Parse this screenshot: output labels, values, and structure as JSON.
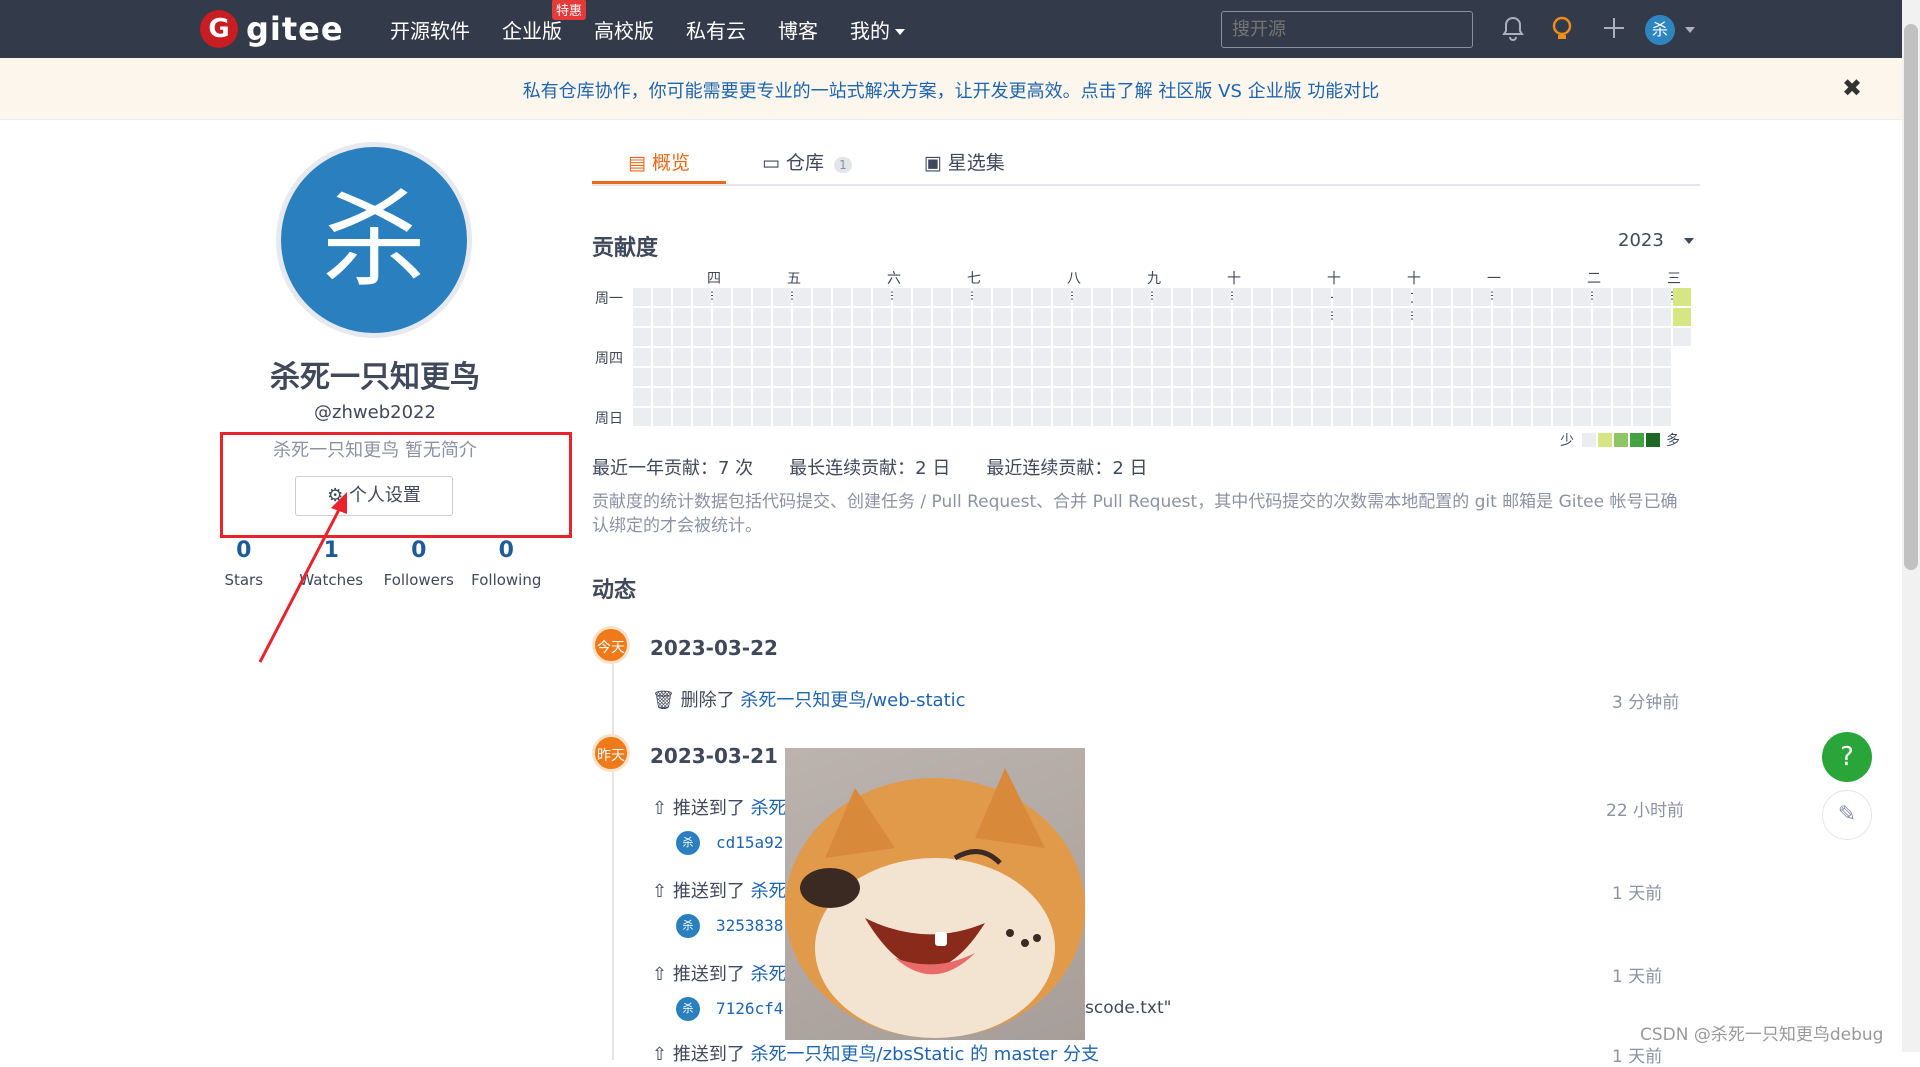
{
  "logo": {
    "mark": "G",
    "text": "gitee"
  },
  "nav": [
    {
      "label": "开源软件"
    },
    {
      "label": "企业版",
      "badge": "特惠"
    },
    {
      "label": "高校版"
    },
    {
      "label": "私有云"
    },
    {
      "label": "博客"
    },
    {
      "label": "我的"
    }
  ],
  "search": {
    "placeholder": "搜开源"
  },
  "user_avatar_initial": "杀",
  "banner": {
    "text": "私有仓库协作，你可能需要更专业的一站式解决方案，让开发更高效。点击了解 社区版 VS 企业版 功能对比",
    "close": "✖"
  },
  "profile": {
    "avatar_initial": "杀",
    "name": "杀死一只知更鸟",
    "username": "@zhweb2022",
    "bio": "杀死一只知更鸟 暂无简介",
    "settings_label": "个人设置",
    "stats": [
      {
        "num": "0",
        "label": "Stars"
      },
      {
        "num": "1",
        "label": "Watches"
      },
      {
        "num": "0",
        "label": "Followers"
      },
      {
        "num": "0",
        "label": "Following"
      }
    ]
  },
  "tabs": [
    {
      "label": "概览",
      "active": true
    },
    {
      "label": "仓库",
      "count": "1"
    },
    {
      "label": "星选集"
    }
  ],
  "contribution": {
    "title": "贡献度",
    "year": "2023",
    "months": [
      "四月",
      "五月",
      "六月",
      "七月",
      "八月",
      "九月",
      "十月",
      "十一月",
      "十二月",
      "一月",
      "二月",
      "三月"
    ],
    "weekdays": [
      "周一",
      "周四",
      "周日"
    ],
    "legend_less": "少",
    "legend_more": "多",
    "legend_colors": [
      "#ebedf0",
      "#d6e685",
      "#8cc665",
      "#44a340",
      "#1e6823"
    ],
    "stats": "最近一年贡献：7 次　　最长连续贡献：2 日　　最近连续贡献：2 日",
    "note": "贡献度的统计数据包括代码提交、创建任务 / Pull Request、合并 Pull Request，其中代码提交的次数需本地配置的 git 邮箱是 Gitee 帐号已确认绑定的才会被统计。"
  },
  "activity": {
    "title": "动态",
    "days": [
      {
        "badge": "今天",
        "date": "2023-03-22"
      },
      {
        "badge": "昨天",
        "date": "2023-03-21"
      }
    ],
    "events": [
      {
        "text": "删除了 ",
        "link": "杀死一只知更鸟/web-static",
        "time": "3 分钟前"
      },
      {
        "text": "推送到了 ",
        "link": "杀死",
        "time": "22 小时前",
        "commit": "cd15a92"
      },
      {
        "text": "推送到了 ",
        "link": "杀死",
        "time": "1 天前",
        "commit": "3253838"
      },
      {
        "text": "推送到了 ",
        "link": "杀死",
        "time": "1 天前",
        "commit": "7126cf4",
        "tail": "scode.txt\""
      },
      {
        "text": "推送到了 ",
        "link": "杀死一只知更鸟/zbsStatic 的 master 分支",
        "time": "1 天前"
      }
    ]
  },
  "watermark": "CSDN @杀死一只知更鸟debug"
}
